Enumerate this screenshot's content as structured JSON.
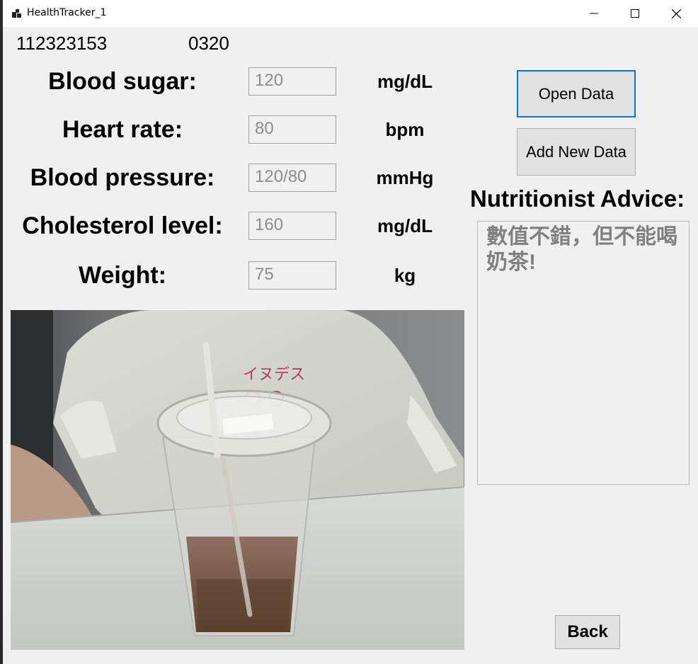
{
  "window": {
    "title": "HealthTracker_1"
  },
  "header": {
    "student_id": "112323153",
    "code": "0320"
  },
  "fields": [
    {
      "label": "Blood sugar:",
      "value": "120",
      "unit": "mg/dL"
    },
    {
      "label": "Heart rate:",
      "value": "80",
      "unit": "bpm"
    },
    {
      "label": "Blood pressure:",
      "value": "120/80",
      "unit": "mmHg"
    },
    {
      "label": "Cholesterol level:",
      "value": "160",
      "unit": "mg/dL"
    },
    {
      "label": "Weight:",
      "value": "75",
      "unit": "kg"
    }
  ],
  "buttons": {
    "open_data": "Open Data",
    "add_new_data": "Add New Data",
    "back": "Back"
  },
  "advice": {
    "title": "Nutritionist Advice:",
    "text": "數值不錯，但不能喝奶茶!"
  },
  "photo": {
    "tshirt_text": "イヌデス"
  },
  "colors": {
    "accent": "#0078d7",
    "window_bg": "#f0f0f0",
    "placeholder_text": "#8c8c8c"
  }
}
